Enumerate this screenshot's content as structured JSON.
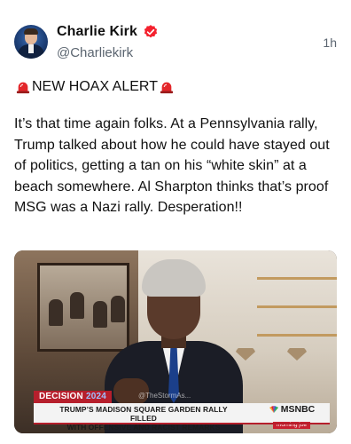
{
  "post": {
    "author_name": "Charlie Kirk",
    "handle": "@Charliekirk",
    "timestamp": "1h",
    "alert_text": "NEW HOAX ALERT",
    "body": "It’s that time again folks. At a Pennsylvania rally, Trump talked about how he could have stayed out of politics, getting a tan on his “white skin” at a beach somewhere. Al Sharpton thinks that’s proof MSG was a Nazi rally. Desperation!!",
    "icons": [
      "avatar",
      "verified-badge-icon",
      "siren-icon"
    ]
  },
  "media": {
    "decision_label": "DECISION",
    "decision_year": "2024",
    "watermark": "@TheStormAs...",
    "headline_line1": "TRUMP’S MADISON SQUARE GARDEN RALLY FILLED",
    "headline_line2": "WITH OFFENSIVE AND RACIST REMARKS",
    "network": "MSNBC",
    "show": "morning joe"
  },
  "colors": {
    "verified": "#f4212e",
    "msnbc_red": "#b61f2c",
    "text": "#0f1419",
    "muted": "#5b6570"
  }
}
